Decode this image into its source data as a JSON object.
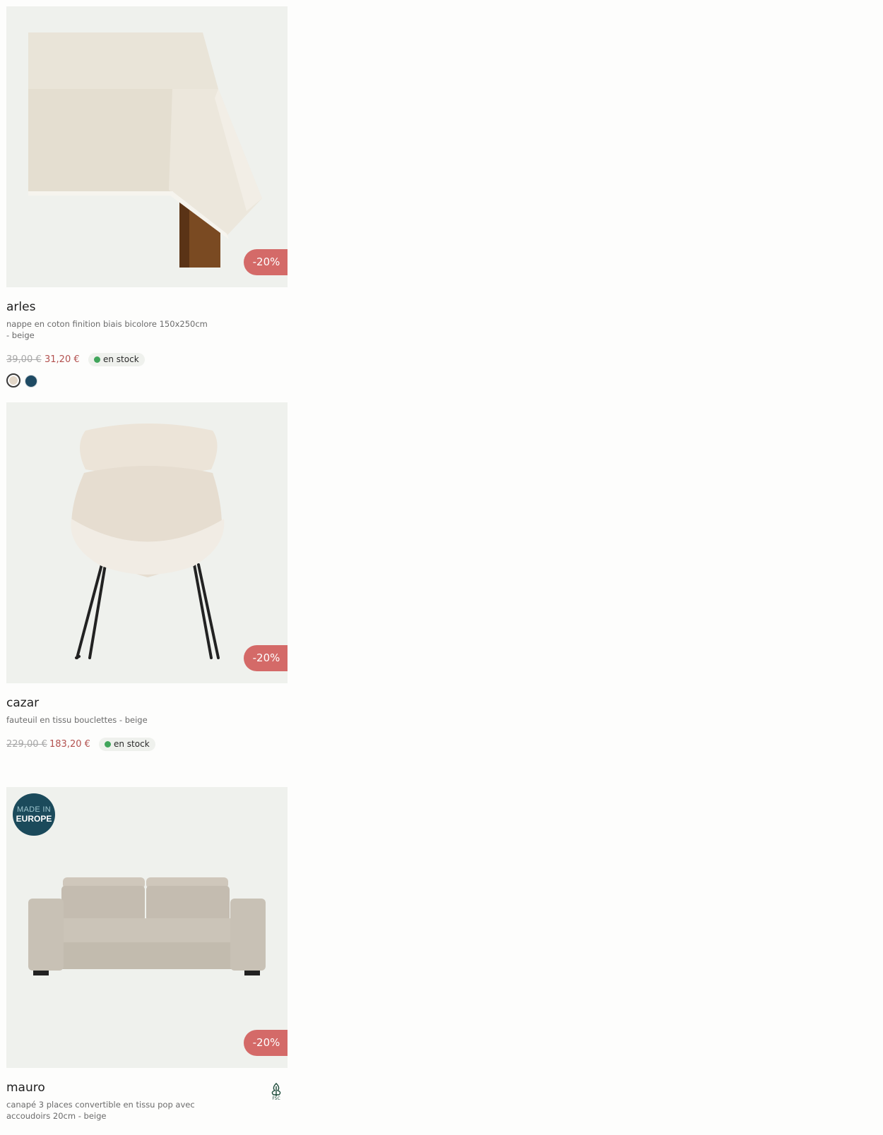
{
  "products": [
    {
      "name": "arles",
      "description": "nappe en coton finition biais bicolore 150x250cm - beige",
      "old_price": "39,00 €",
      "new_price": "31,20 €",
      "stock": "en stock",
      "discount": "-20%",
      "swatches": [
        "#e3d7c8",
        "#1e4a63"
      ]
    },
    {
      "name": "cazar",
      "description": "fauteuil en tissu bouclettes - beige",
      "old_price": "229,00 €",
      "new_price": "183,20 €",
      "stock": "en stock",
      "discount": "-20%"
    },
    {
      "name": "mauro",
      "description": "canapé 3 places convertible en tissu pop avec accoudoirs 20cm - beige",
      "discount": "-20%",
      "badge_line1": "MADE IN",
      "badge_line2": "EUROPE",
      "label_icon": "fsc-tree-icon"
    }
  ],
  "colors": {
    "discount": "#d46a68",
    "new_price": "#b3514f",
    "stock_dot": "#41a55b",
    "badge_bg": "#1b4a5b",
    "image_bg": "#eff1ed"
  }
}
